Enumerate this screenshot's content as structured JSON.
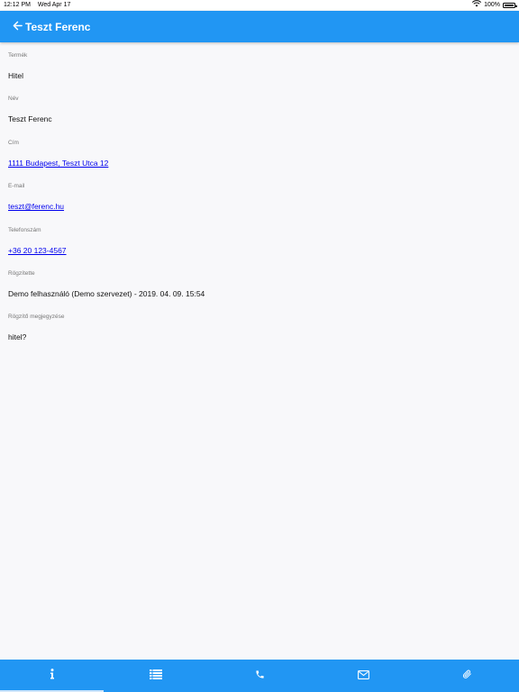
{
  "statusbar": {
    "time": "12:12 PM",
    "date": "Wed Apr 17",
    "battery": "100%"
  },
  "appbar": {
    "title": "Teszt Ferenc",
    "back_icon": "arrow-left-icon"
  },
  "fields": [
    {
      "label": "Termék",
      "value": "Hitel",
      "link": false
    },
    {
      "label": "Név",
      "value": "Teszt Ferenc",
      "link": false
    },
    {
      "label": "Cím",
      "value": "1111 Budapest, Teszt Utca 12",
      "link": true
    },
    {
      "label": "E-mail",
      "value": "teszt@ferenc.hu",
      "link": true
    },
    {
      "label": "Telefonszám",
      "value": "+36 20 123-4567",
      "link": true
    },
    {
      "label": "Rögzítette",
      "value": "Demo felhasználó (Demo szervezet) - 2019. 04. 09. 15:54",
      "link": false
    },
    {
      "label": "Rögzítő megjegyzése",
      "value": "hitel?",
      "link": false
    }
  ],
  "tabbar": {
    "active_index": 0,
    "tabs": [
      {
        "icon": "info-icon"
      },
      {
        "icon": "list-icon"
      },
      {
        "icon": "phone-icon"
      },
      {
        "icon": "mail-icon"
      },
      {
        "icon": "paperclip-icon"
      }
    ]
  },
  "colors": {
    "primary": "#2196f3",
    "background": "#f8f8fa",
    "link": "#0000ee"
  }
}
